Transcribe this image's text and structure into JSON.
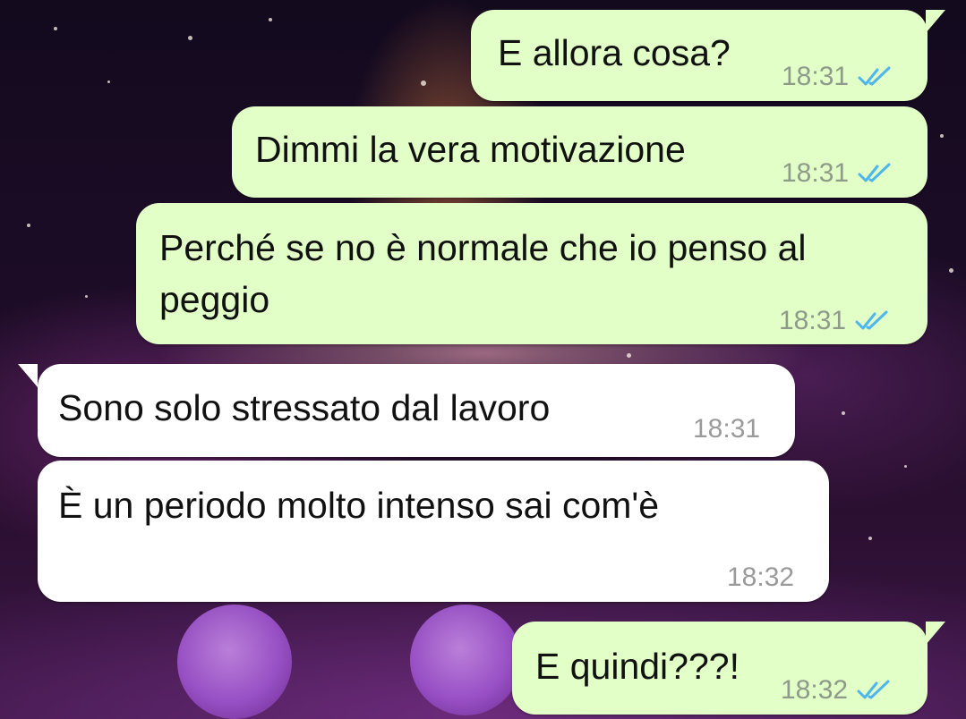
{
  "messages": [
    {
      "direction": "outgoing",
      "lines": [
        "E allora cosa?"
      ],
      "time": "18:31",
      "status_icon": "double-check-read-icon"
    },
    {
      "direction": "outgoing",
      "lines": [
        "Dimmi la vera motivazione"
      ],
      "time": "18:31",
      "status_icon": "double-check-read-icon"
    },
    {
      "direction": "outgoing",
      "lines": [
        "Perché se no è normale che io penso al",
        "peggio"
      ],
      "time": "18:31",
      "status_icon": "double-check-read-icon"
    },
    {
      "direction": "incoming",
      "lines": [
        "Sono solo stressato dal lavoro"
      ],
      "time": "18:31"
    },
    {
      "direction": "incoming",
      "lines": [
        "È un periodo molto intenso sai com'è"
      ],
      "time": "18:32"
    },
    {
      "direction": "outgoing",
      "lines": [
        "E quindi???!"
      ],
      "time": "18:32",
      "status_icon": "double-check-read-icon"
    }
  ],
  "colors": {
    "outgoing_bubble": "#e1ffc7",
    "incoming_bubble": "#ffffff",
    "read_tick": "#4fb6ec",
    "timestamp": "#8e9a8a"
  }
}
